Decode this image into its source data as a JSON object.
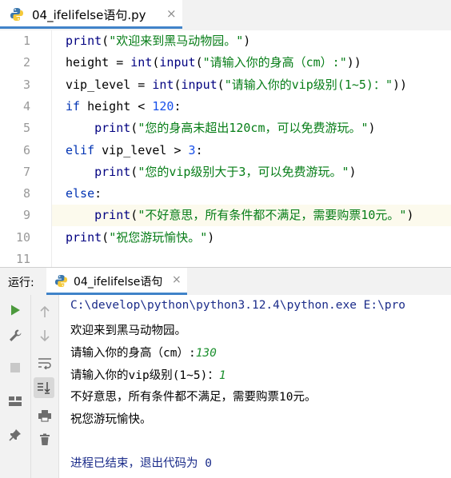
{
  "editor_tab": {
    "filename": "04_ifelifelse语句.py",
    "close": "×"
  },
  "editor": {
    "line_numbers": [
      "1",
      "2",
      "3",
      "4",
      "5",
      "6",
      "7",
      "8",
      "9",
      "10",
      "11"
    ],
    "lines": [
      [
        {
          "t": "print",
          "c": "fn"
        },
        {
          "t": "(",
          "c": "op"
        },
        {
          "t": "\"欢迎来到黑马动物园。\"",
          "c": "str"
        },
        {
          "t": ")",
          "c": "op"
        }
      ],
      [
        {
          "t": "height = ",
          "c": "op"
        },
        {
          "t": "int",
          "c": "fn"
        },
        {
          "t": "(",
          "c": "op"
        },
        {
          "t": "input",
          "c": "fn"
        },
        {
          "t": "(",
          "c": "op"
        },
        {
          "t": "\"请输入你的身高（cm）:\"",
          "c": "str"
        },
        {
          "t": "))",
          "c": "op"
        }
      ],
      [
        {
          "t": "vip_level = ",
          "c": "op"
        },
        {
          "t": "int",
          "c": "fn"
        },
        {
          "t": "(",
          "c": "op"
        },
        {
          "t": "input",
          "c": "fn"
        },
        {
          "t": "(",
          "c": "op"
        },
        {
          "t": "\"请输入你的vip级别(1~5)：\"",
          "c": "str"
        },
        {
          "t": "))",
          "c": "op"
        }
      ],
      [
        {
          "t": "if",
          "c": "kw"
        },
        {
          "t": " height < ",
          "c": "op"
        },
        {
          "t": "120",
          "c": "num"
        },
        {
          "t": ":",
          "c": "op"
        }
      ],
      [
        {
          "t": "    ",
          "c": "op"
        },
        {
          "t": "print",
          "c": "fn"
        },
        {
          "t": "(",
          "c": "op"
        },
        {
          "t": "\"您的身高未超出120cm，可以免费游玩。\"",
          "c": "str"
        },
        {
          "t": ")",
          "c": "op"
        }
      ],
      [
        {
          "t": "elif",
          "c": "kw"
        },
        {
          "t": " vip_level > ",
          "c": "op"
        },
        {
          "t": "3",
          "c": "num"
        },
        {
          "t": ":",
          "c": "op"
        }
      ],
      [
        {
          "t": "    ",
          "c": "op"
        },
        {
          "t": "print",
          "c": "fn"
        },
        {
          "t": "(",
          "c": "op"
        },
        {
          "t": "\"您的vip级别大于3，可以免费游玩。\"",
          "c": "str"
        },
        {
          "t": ")",
          "c": "op"
        }
      ],
      [
        {
          "t": "else",
          "c": "kw"
        },
        {
          "t": ":",
          "c": "op"
        }
      ],
      [
        {
          "t": "    ",
          "c": "op"
        },
        {
          "t": "print",
          "c": "fn"
        },
        {
          "t": "(",
          "c": "op"
        },
        {
          "t": "\"不好意思，所有条件都不满足，需要购票10元。\"",
          "c": "str"
        },
        {
          "t": ")",
          "c": "op"
        }
      ],
      [
        {
          "t": "print",
          "c": "fn"
        },
        {
          "t": "(",
          "c": "op"
        },
        {
          "t": "\"祝您游玩愉快。\"",
          "c": "str"
        },
        {
          "t": ")",
          "c": "op"
        }
      ],
      []
    ],
    "highlighted_line": 9
  },
  "run_panel": {
    "label": "运行:",
    "tab_name": "04_ifelifelse语句",
    "close": "×"
  },
  "console": {
    "command": "C:\\develop\\python\\python3.12.4\\python.exe E:\\pro",
    "welcome": "欢迎来到黑马动物园。",
    "prompt_height": "请输入你的身高（cm）:",
    "input_height": "130",
    "prompt_vip": "请输入你的vip级别(1~5)：",
    "input_vip": "1",
    "result": "不好意思，所有条件都不满足，需要购票10元。",
    "farewell": "祝您游玩愉快。",
    "exit_message": "进程已结束，退出代码为 0"
  },
  "colors": {
    "keyword": "#0033b3",
    "string": "#067d17",
    "number": "#1750eb",
    "accent": "#4083c9",
    "user_input": "#1b8f2e"
  }
}
